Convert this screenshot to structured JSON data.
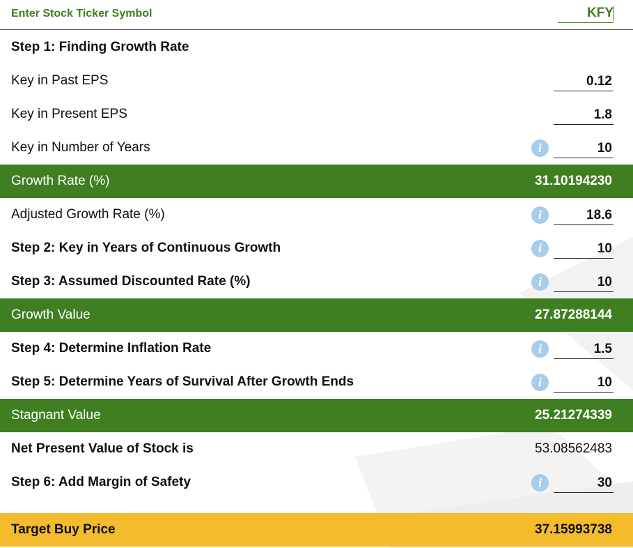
{
  "ticker": {
    "label": "Enter Stock Ticker Symbol",
    "value": "KFY"
  },
  "step1": {
    "title": "Step 1: Finding Growth Rate"
  },
  "past_eps": {
    "label": "Key in Past EPS",
    "value": "0.12"
  },
  "present_eps": {
    "label": "Key in Present EPS",
    "value": "1.8"
  },
  "num_years": {
    "label": "Key in Number of Years",
    "value": "10"
  },
  "growth_rate": {
    "label": "Growth Rate (%)",
    "value": "31.10194230"
  },
  "adjusted_growth": {
    "label": "Adjusted Growth Rate (%)",
    "value": "18.6"
  },
  "step2": {
    "label": "Step 2: Key in Years of Continuous Growth",
    "value": "10"
  },
  "step3": {
    "label": "Step 3: Assumed Discounted Rate (%)",
    "value": "10"
  },
  "growth_value": {
    "label": "Growth Value",
    "value": "27.87288144"
  },
  "step4": {
    "label": "Step 4: Determine Inflation Rate",
    "value": "1.5"
  },
  "step5": {
    "label": "Step 5: Determine Years of Survival After Growth Ends",
    "value": "10"
  },
  "stagnant_value": {
    "label": "Stagnant Value",
    "value": "25.21274339"
  },
  "npv": {
    "label": "Net Present Value of Stock is",
    "value": "53.08562483"
  },
  "step6": {
    "label": "Step 6: Add Margin of Safety",
    "value": "30"
  },
  "target_price": {
    "label": "Target Buy Price",
    "value": "37.15993738"
  },
  "info_glyph": "i",
  "colors": {
    "green": "#3f7f22",
    "yellow": "#f4bc2c",
    "info": "#a8cdea"
  }
}
